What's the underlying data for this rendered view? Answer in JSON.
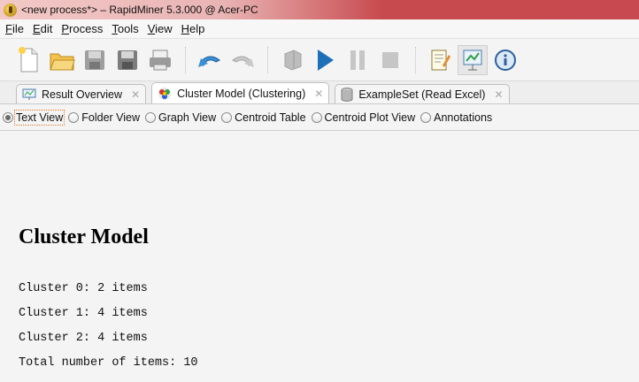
{
  "window": {
    "title": "<new process*> – RapidMiner 5.3.000 @ Acer-PC"
  },
  "menu": [
    {
      "label": "File",
      "mnemonic": "F",
      "rest": "ile"
    },
    {
      "label": "Edit",
      "mnemonic": "E",
      "rest": "dit"
    },
    {
      "label": "Process",
      "mnemonic": "P",
      "rest": "rocess"
    },
    {
      "label": "Tools",
      "mnemonic": "T",
      "rest": "ools"
    },
    {
      "label": "View",
      "mnemonic": "V",
      "rest": "iew"
    },
    {
      "label": "Help",
      "mnemonic": "H",
      "rest": "elp"
    }
  ],
  "toolbar": {
    "icons": [
      "new-process-icon",
      "open-folder-icon",
      "save-icon",
      "save-as-icon",
      "print-icon",
      "undo-icon",
      "redo-icon",
      "stop-all-icon",
      "run-icon",
      "pause-icon",
      "stop-icon",
      "design-perspective-icon",
      "results-perspective-icon",
      "info-icon"
    ]
  },
  "tabs": [
    {
      "label": "Result Overview",
      "icon": "result-overview-icon",
      "active": false
    },
    {
      "label": "Cluster Model (Clustering)",
      "icon": "cluster-model-icon",
      "active": true
    },
    {
      "label": "ExampleSet (Read Excel)",
      "icon": "database-icon",
      "active": false
    }
  ],
  "views": [
    {
      "label": "Text View",
      "checked": true
    },
    {
      "label": "Folder View",
      "checked": false
    },
    {
      "label": "Graph View",
      "checked": false
    },
    {
      "label": "Centroid Table",
      "checked": false
    },
    {
      "label": "Centroid Plot View",
      "checked": false
    },
    {
      "label": "Annotations",
      "checked": false
    }
  ],
  "result": {
    "title": "Cluster Model",
    "lines": [
      "Cluster 0: 2 items",
      "Cluster 1: 4 items",
      "Cluster 2: 4 items",
      "Total number of items: 10"
    ]
  },
  "colors": {
    "title_accent": "#c74a4e",
    "focus_outline": "#e07b28",
    "run_blue": "#1f6fb8"
  }
}
